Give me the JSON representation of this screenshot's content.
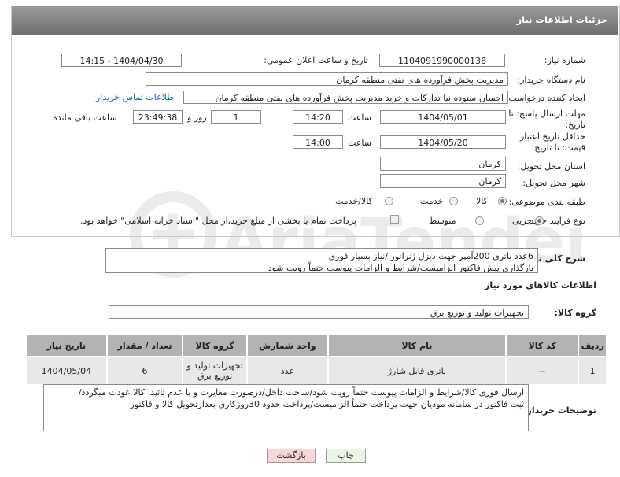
{
  "header": {
    "title": "جزئیات اطلاعات نیاز"
  },
  "form": {
    "need_number_label": "شماره نیاز:",
    "need_number": "1104091990000136",
    "announce_label": "تاریخ و ساعت اعلان عمومی:",
    "announce_value": "1404/04/30 - 14:15",
    "buyer_label": "نام دستگاه خریدار:",
    "buyer_value": "مدیریت پخش فرآورده های نفتی منطقه کرمان",
    "creator_label": "ایجاد کننده درخواست:",
    "creator_value": "احسان  ستوده نیا  تدارکات و خرید  مدیریت پخش فرآورده های نفتی منطقه کرمان",
    "contact_link": "اطلاعات تماس خریدار",
    "deadline_label": "مهلت ارسال پاسخ: تا تاریخ:",
    "deadline_date": "1404/05/01",
    "time_label": "ساعت",
    "deadline_time": "14:20",
    "days_value": "1",
    "days_label": "روز و",
    "remaining_time": "23:49:38",
    "remaining_label": "ساعت باقی مانده",
    "validity_label": "حداقل تاریخ اعتبار قیمت: تا تاریخ:",
    "validity_date": "1404/05/20",
    "validity_time": "14:00",
    "province_label": "استان محل تحویل:",
    "province_value": "کرمان",
    "city_label": "شهر محل تحویل:",
    "city_value": "کرمان",
    "category_label": "طبقه بندی موضوعی:",
    "category_options": [
      "کالا",
      "خدمت",
      "کالا/خدمت"
    ],
    "process_label": "نوع فرآیند خرید :",
    "process_options": [
      "جزیی",
      "متوسط"
    ],
    "payment_note": "پرداخت تمام یا بخشی از مبلغ خرید،از محل \"اسناد خزانه اسلامی\" خواهد بود."
  },
  "description": {
    "label": "شرح کلی نیاز:",
    "line1": "6عدد باتری 200آمپر جهت دیزل ژنراتور /نیاز بسیار فوری",
    "line2": "بارگذاری پیش فاکتور الزامیست/شرایط و الزامات پیوست حتماً رویت شود"
  },
  "goods": {
    "section_title": "اطلاعات کالاهای مورد نیاز",
    "group_label": "گروه کالا:",
    "group_value": "تجهیزات تولید و توزیع برق",
    "columns": [
      "ردیف",
      "کد کالا",
      "نام کالا",
      "واحد شمارش",
      "گروه کالا",
      "تعداد / مقدار",
      "تاریخ نیاز"
    ],
    "rows": [
      {
        "row": "1",
        "code": "--",
        "name": "باتری قابل شارژ",
        "unit": "عدد",
        "group": "تجهیزات تولید و توزیع برق",
        "qty": "6",
        "date": "1404/05/04"
      }
    ]
  },
  "buyer_notes": {
    "label": "توضیحات خریدار:",
    "line1": "ارسال فوری کالا/شرایط و الزامات پیوست حتماً رویت شود/ساخت داخل/درصورت مغایرت و یا عدم تائید، کالا عودت میگردد/",
    "line2": "ثبت فاکتور در سامانه مودیان جهت پرداخت حتماً الزامیست/پرداخت حدود 30روزکاری بعدازتحویل کالا و فاکتور"
  },
  "buttons": {
    "print": "چاپ",
    "back": "بازگشت"
  },
  "watermark": {
    "brand": "AriaTender.net"
  },
  "colors": {
    "header": "#7f7f7f",
    "link": "#1c63b7",
    "back_button": "#f6d6d6",
    "print_button": "#eaf5e6"
  }
}
